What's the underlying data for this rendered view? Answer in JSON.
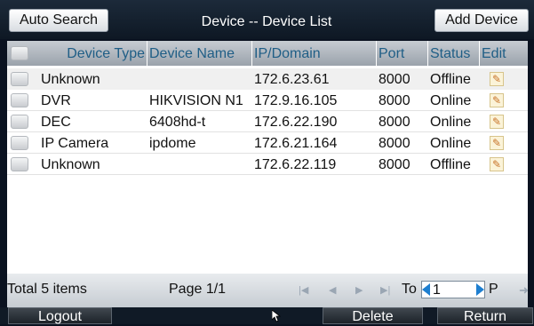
{
  "header": {
    "auto_search_label": "Auto Search",
    "title": "Device -- Device List",
    "add_device_label": "Add Device"
  },
  "table": {
    "columns": [
      "Device Type",
      "Device Name",
      "IP/Domain",
      "Port",
      "Status",
      "Edit"
    ],
    "rows": [
      {
        "type": "Unknown",
        "name": "",
        "ip": "172.6.23.61",
        "port": "8000",
        "status": "Offline"
      },
      {
        "type": "DVR",
        "name": "HIKVISION N1",
        "ip": "172.9.16.105",
        "port": "8000",
        "status": "Online"
      },
      {
        "type": "DEC",
        "name": "6408hd-t",
        "ip": "172.6.22.190",
        "port": "8000",
        "status": "Online"
      },
      {
        "type": "IP Camera",
        "name": "ipdome",
        "ip": "172.6.21.164",
        "port": "8000",
        "status": "Online"
      },
      {
        "type": "Unknown",
        "name": "",
        "ip": "172.6.22.119",
        "port": "8000",
        "status": "Offline"
      }
    ]
  },
  "footer": {
    "total": "Total 5 items",
    "page": "Page 1/1",
    "to_label": "To",
    "page_input_value": "1",
    "p_label": "P",
    "nav_icons": [
      "first-page-icon",
      "prev-page-icon",
      "next-page-icon",
      "last-page-icon",
      "go-icon"
    ]
  },
  "bottom": {
    "logout_label": "Logout",
    "delete_label": "Delete",
    "return_label": "Return"
  },
  "colors": {
    "header_text": "#1f5e86",
    "accent_arrow": "#1e7fd0",
    "background": "#0a1220"
  }
}
